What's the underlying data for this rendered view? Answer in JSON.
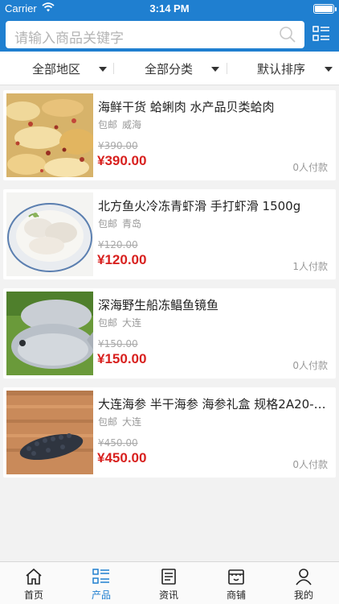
{
  "status": {
    "carrier": "Carrier",
    "time": "3:14 PM"
  },
  "search": {
    "placeholder": "请输入商品关键字"
  },
  "filters": [
    {
      "label": "全部地区"
    },
    {
      "label": "全部分类"
    },
    {
      "label": "默认排序"
    }
  ],
  "products": [
    {
      "title": "海鲜干货 蛤蜊肉 水产品贝类蛤肉",
      "shipping": "包邮",
      "city": "威海",
      "old_price": "¥390.00",
      "price": "¥390.00",
      "paid": "0人付款",
      "image": "clam-meat-photo"
    },
    {
      "title": "北方鱼火冷冻青虾滑 手打虾滑 1500g",
      "shipping": "包邮",
      "city": "青岛",
      "old_price": "¥120.00",
      "price": "¥120.00",
      "paid": "1人付款",
      "image": "shrimp-paste-photo"
    },
    {
      "title": "深海野生船冻鲳鱼镜鱼",
      "shipping": "包邮",
      "city": "大连",
      "old_price": "¥150.00",
      "price": "¥150.00",
      "paid": "0人付款",
      "image": "pomfret-fish-photo"
    },
    {
      "title": "大连海参 半干海参 海参礼盒 规格2A20-1...",
      "shipping": "包邮",
      "city": "大连",
      "old_price": "¥450.00",
      "price": "¥450.00",
      "paid": "0人付款",
      "image": "sea-cucumber-photo"
    }
  ],
  "tabs": [
    {
      "label": "首页",
      "icon": "home-icon",
      "active": false
    },
    {
      "label": "产品",
      "icon": "product-list-icon",
      "active": true
    },
    {
      "label": "资讯",
      "icon": "news-icon",
      "active": false
    },
    {
      "label": "商铺",
      "icon": "shop-icon",
      "active": false
    },
    {
      "label": "我的",
      "icon": "user-icon",
      "active": false
    }
  ],
  "colors": {
    "brand": "#1f7fd0",
    "price": "#d8211f"
  }
}
